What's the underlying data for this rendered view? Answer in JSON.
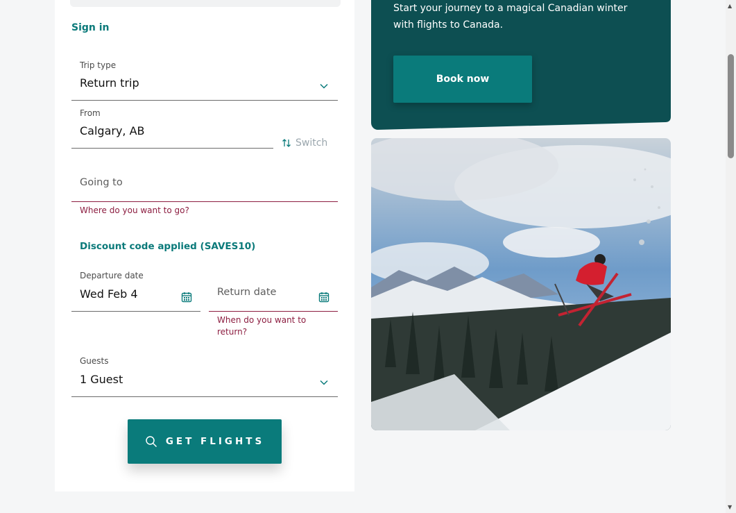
{
  "form": {
    "sign_in": "Sign in",
    "trip_type": {
      "label": "Trip type",
      "value": "Return trip"
    },
    "from": {
      "label": "From",
      "value": "Calgary, AB"
    },
    "switch_label": "Switch",
    "going_to": {
      "placeholder": "Going to",
      "error": "Where do you want to go?"
    },
    "discount": "Discount code applied (SAVES10)",
    "departure": {
      "label": "Departure date",
      "value": "Wed Feb 4"
    },
    "return": {
      "placeholder": "Return date",
      "error_line1": "When do you want to",
      "error_line2": "return?"
    },
    "guests": {
      "label": "Guests",
      "value": "1 Guest"
    },
    "submit_label": "GET FLIGHTS"
  },
  "promo": {
    "line1": "Start your journey to a magical Canadian winter",
    "line2": "with flights to Canada.",
    "book_label": "Book now"
  },
  "colors": {
    "accent": "#0a7b7b",
    "promo_bg": "#0d4f52",
    "error": "#8c1d40",
    "link": "#0b7a7a"
  },
  "icons": [
    "chevron-down-icon",
    "switch-arrows-icon",
    "calendar-icon",
    "search-icon"
  ]
}
